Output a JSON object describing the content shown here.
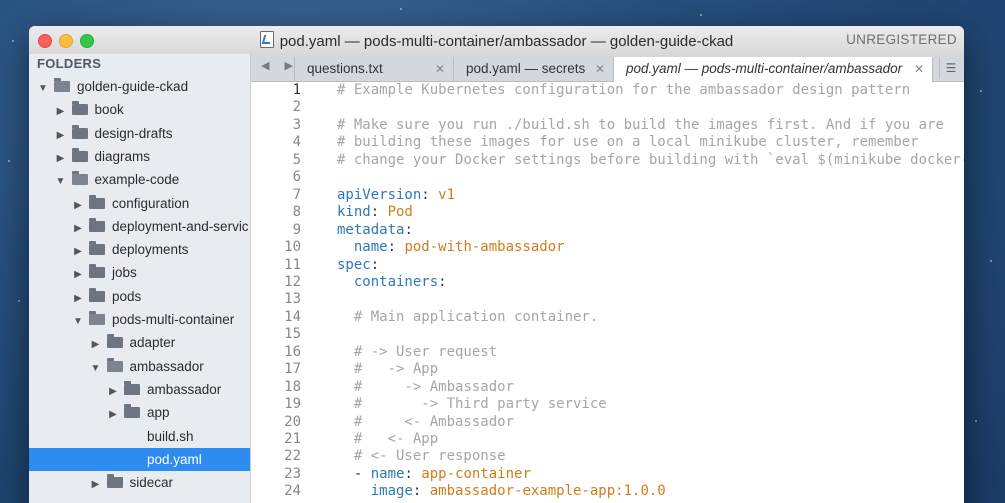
{
  "window": {
    "title": "pod.yaml — pods-multi-container/ambassador — golden-guide-ckad",
    "license_status": "UNREGISTERED"
  },
  "sidebar": {
    "header": "FOLDERS",
    "items": [
      {
        "label": "golden-guide-ckad",
        "depth": 0,
        "type": "folder",
        "expanded": true
      },
      {
        "label": "book",
        "depth": 1,
        "type": "folder",
        "expanded": false
      },
      {
        "label": "design-drafts",
        "depth": 1,
        "type": "folder",
        "expanded": false
      },
      {
        "label": "diagrams",
        "depth": 1,
        "type": "folder",
        "expanded": false
      },
      {
        "label": "example-code",
        "depth": 1,
        "type": "folder",
        "expanded": true
      },
      {
        "label": "configuration",
        "depth": 2,
        "type": "folder",
        "expanded": false
      },
      {
        "label": "deployment-and-servic",
        "depth": 2,
        "type": "folder",
        "expanded": false
      },
      {
        "label": "deployments",
        "depth": 2,
        "type": "folder",
        "expanded": false
      },
      {
        "label": "jobs",
        "depth": 2,
        "type": "folder",
        "expanded": false
      },
      {
        "label": "pods",
        "depth": 2,
        "type": "folder",
        "expanded": false
      },
      {
        "label": "pods-multi-container",
        "depth": 2,
        "type": "folder",
        "expanded": true
      },
      {
        "label": "adapter",
        "depth": 3,
        "type": "folder",
        "expanded": false
      },
      {
        "label": "ambassador",
        "depth": 3,
        "type": "folder",
        "expanded": true
      },
      {
        "label": "ambassador",
        "depth": 4,
        "type": "folder",
        "expanded": false
      },
      {
        "label": "app",
        "depth": 4,
        "type": "folder",
        "expanded": false
      },
      {
        "label": "build.sh",
        "depth": 4,
        "type": "file"
      },
      {
        "label": "pod.yaml",
        "depth": 4,
        "type": "file",
        "selected": true
      },
      {
        "label": "sidecar",
        "depth": 3,
        "type": "folder",
        "expanded": false
      }
    ]
  },
  "tabs": [
    {
      "label": "questions.txt",
      "active": false
    },
    {
      "label": "pod.yaml — secrets",
      "active": false
    },
    {
      "label": "pod.yaml — pods-multi-container/ambassador",
      "active": true
    }
  ],
  "editor": {
    "current_line": 1,
    "lines": [
      {
        "n": "1",
        "t": [
          [
            "c",
            "# Example Kubernetes configuration for the ambassador design pattern"
          ]
        ]
      },
      {
        "n": "2",
        "t": []
      },
      {
        "n": "3",
        "t": [
          [
            "c",
            "# Make sure you run ./build.sh to build the images first. And if you are"
          ]
        ]
      },
      {
        "n": "4",
        "t": [
          [
            "c",
            "# building these images for use on a local minikube cluster, remember"
          ]
        ]
      },
      {
        "n": "5",
        "t": [
          [
            "c",
            "# change your Docker settings before building with `eval $(minikube docker-env)`"
          ]
        ]
      },
      {
        "n": "6",
        "t": []
      },
      {
        "n": "7",
        "t": [
          [
            "k",
            "apiVersion"
          ],
          [
            "p",
            ": "
          ],
          [
            "v",
            "v1"
          ]
        ]
      },
      {
        "n": "8",
        "t": [
          [
            "k",
            "kind"
          ],
          [
            "p",
            ": "
          ],
          [
            "v",
            "Pod"
          ]
        ]
      },
      {
        "n": "9",
        "t": [
          [
            "k",
            "metadata"
          ],
          [
            "p",
            ":"
          ]
        ]
      },
      {
        "n": "10",
        "t": [
          [
            "p",
            "  "
          ],
          [
            "k",
            "name"
          ],
          [
            "p",
            ": "
          ],
          [
            "v",
            "pod-with-ambassador"
          ]
        ]
      },
      {
        "n": "11",
        "t": [
          [
            "k",
            "spec"
          ],
          [
            "p",
            ":"
          ]
        ]
      },
      {
        "n": "12",
        "t": [
          [
            "p",
            "  "
          ],
          [
            "k",
            "containers"
          ],
          [
            "p",
            ":"
          ]
        ]
      },
      {
        "n": "13",
        "t": []
      },
      {
        "n": "14",
        "t": [
          [
            "c",
            "  # Main application container."
          ]
        ]
      },
      {
        "n": "15",
        "t": []
      },
      {
        "n": "16",
        "t": [
          [
            "c",
            "  # -> User request"
          ]
        ]
      },
      {
        "n": "17",
        "t": [
          [
            "c",
            "  #   -> App"
          ]
        ]
      },
      {
        "n": "18",
        "t": [
          [
            "c",
            "  #     -> Ambassador"
          ]
        ]
      },
      {
        "n": "19",
        "t": [
          [
            "c",
            "  #       -> Third party service"
          ]
        ]
      },
      {
        "n": "20",
        "t": [
          [
            "c",
            "  #     <- Ambassador"
          ]
        ]
      },
      {
        "n": "21",
        "t": [
          [
            "c",
            "  #   <- App"
          ]
        ]
      },
      {
        "n": "22",
        "t": [
          [
            "c",
            "  # <- User response"
          ]
        ]
      },
      {
        "n": "23",
        "t": [
          [
            "p",
            "  - "
          ],
          [
            "k",
            "name"
          ],
          [
            "p",
            ": "
          ],
          [
            "v",
            "app-container"
          ]
        ]
      },
      {
        "n": "24",
        "t": [
          [
            "p",
            "    "
          ],
          [
            "k",
            "image"
          ],
          [
            "p",
            ": "
          ],
          [
            "v",
            "ambassador-example-app:1.0.0"
          ]
        ]
      }
    ]
  },
  "colors": {
    "selection": "#2e8cf0",
    "comment": "#a6a6a6",
    "key": "#2d78b8",
    "value": "#d07d1c"
  }
}
